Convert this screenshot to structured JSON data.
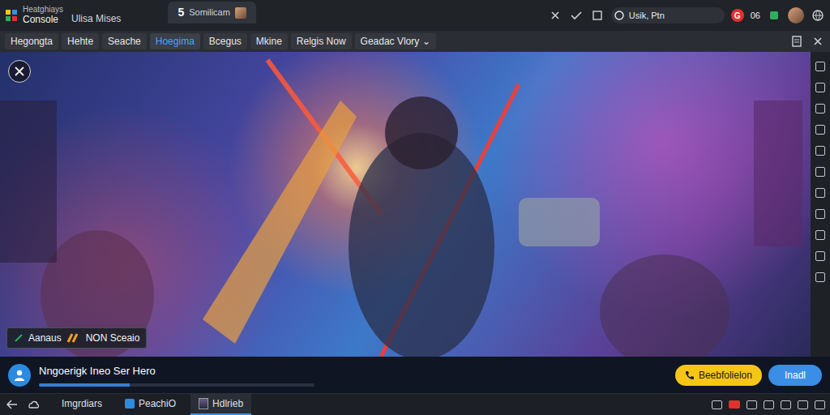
{
  "title_bar": {
    "app_lines": [
      "Heatghiays",
      "Console"
    ],
    "subtitle": "Ulisa Mises",
    "tab": {
      "count": "5",
      "label": "Somilicam",
      "selected": true
    },
    "address": "Usik, Ptn",
    "account_logo": "G",
    "account_count": "06"
  },
  "nav": {
    "items": [
      {
        "label": "Hegongta",
        "selected": false,
        "kind": "link"
      },
      {
        "label": "Hehte",
        "selected": false,
        "kind": "link"
      },
      {
        "label": "Seache",
        "selected": false,
        "kind": "link"
      },
      {
        "label": "Hoegima",
        "selected": true,
        "kind": "link"
      },
      {
        "label": "Bcegus",
        "selected": false,
        "kind": "link"
      },
      {
        "label": "Mkine",
        "selected": false,
        "kind": "link"
      },
      {
        "label": "Relgis Now",
        "selected": false,
        "kind": "link"
      },
      {
        "label": "Geadac Vlory",
        "selected": false,
        "kind": "dropdown",
        "caret": "⌄"
      }
    ]
  },
  "banner": {
    "overlay": {
      "label": "Aanaus",
      "tag": "NON Sceaio"
    }
  },
  "now_playing": {
    "title": "Nngoerigk Ineo Ser Hero",
    "level": 0.33,
    "call_button": "Beebfolielon",
    "install_button": "Inadl"
  },
  "taskbar": {
    "items": [
      {
        "label": "Imgrdiars",
        "selected": false,
        "kind": "plain"
      },
      {
        "label": "PeachiO",
        "selected": false,
        "kind": "app"
      },
      {
        "label": "Hdlrieb",
        "selected": true,
        "kind": "window"
      }
    ]
  }
}
